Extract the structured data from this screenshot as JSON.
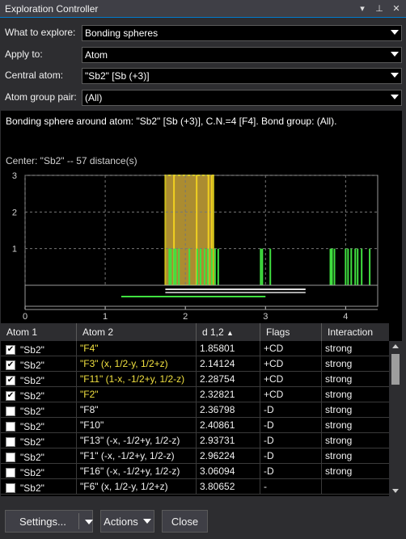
{
  "window": {
    "title": "Exploration Controller"
  },
  "form": {
    "explore_label": "What to explore:",
    "explore_value": "Bonding spheres",
    "apply_label": "Apply to:",
    "apply_value": "Atom",
    "central_label": "Central atom:",
    "central_value": "\"Sb2\" [Sb (+3)]",
    "pair_label": "Atom group pair:",
    "pair_value": "(All)"
  },
  "info": {
    "description": "Bonding sphere around atom: \"Sb2\" [Sb (+3)], C.N.=4 [F4]. Bond group: (All).",
    "center": "Center: \"Sb2\" -- 57 distance(s)"
  },
  "chart_data": {
    "type": "bar",
    "title": "",
    "x_ticks": [
      "0",
      "1",
      "2",
      "3",
      "4"
    ],
    "y_ticks": [
      "1",
      "2",
      "3"
    ],
    "xlim": [
      0,
      4.4
    ],
    "ylim": [
      0,
      3
    ],
    "highlight_range": [
      1.75,
      2.35
    ],
    "series": [
      {
        "values_x": [
          1.858,
          2.141,
          2.288,
          2.328
        ],
        "values_y": [
          3,
          3,
          3,
          3
        ],
        "color": "#f0d020"
      },
      {
        "values_x": [
          1.8,
          1.82,
          1.86,
          1.88,
          1.92,
          2.05,
          2.15,
          2.19,
          2.24,
          2.28,
          2.33,
          2.37,
          2.41,
          2.94,
          2.96,
          3.06,
          3.81,
          3.83,
          3.86,
          4.0,
          4.03,
          4.07,
          4.12,
          4.15,
          4.2,
          4.3
        ],
        "values_y": [
          1,
          1,
          1,
          1,
          1,
          1,
          1,
          1,
          1,
          1,
          1,
          1,
          1,
          1,
          1,
          1,
          1,
          1,
          1,
          1,
          1,
          1,
          1,
          1,
          1,
          1
        ],
        "color": "#40e040"
      }
    ]
  },
  "table": {
    "headers": [
      "Atom 1",
      "Atom 2",
      "d 1,2",
      "Flags",
      "Interaction"
    ],
    "rows": [
      {
        "checked": true,
        "a1": "\"Sb2\"",
        "a2": "\"F4\"",
        "d": "1.85801",
        "flags": "+CD",
        "inter": "strong",
        "hl": true
      },
      {
        "checked": true,
        "a1": "\"Sb2\"",
        "a2": "\"F3\" (x, 1/2-y, 1/2+z)",
        "d": "2.14124",
        "flags": "+CD",
        "inter": "strong",
        "hl": true
      },
      {
        "checked": true,
        "a1": "\"Sb2\"",
        "a2": "\"F11\" (1-x, -1/2+y, 1/2-z)",
        "d": "2.28754",
        "flags": "+CD",
        "inter": "strong",
        "hl": true
      },
      {
        "checked": true,
        "a1": "\"Sb2\"",
        "a2": "\"F2\"",
        "d": "2.32821",
        "flags": "+CD",
        "inter": "strong",
        "hl": true
      },
      {
        "checked": false,
        "a1": "\"Sb2\"",
        "a2": "\"F8\"",
        "d": "2.36798",
        "flags": "-D",
        "inter": "strong",
        "hl": false
      },
      {
        "checked": false,
        "a1": "\"Sb2\"",
        "a2": "\"F10\"",
        "d": "2.40861",
        "flags": "-D",
        "inter": "strong",
        "hl": false
      },
      {
        "checked": false,
        "a1": "\"Sb2\"",
        "a2": "\"F13\" (-x, -1/2+y, 1/2-z)",
        "d": "2.93731",
        "flags": "-D",
        "inter": "strong",
        "hl": false
      },
      {
        "checked": false,
        "a1": "\"Sb2\"",
        "a2": "\"F1\" (-x, -1/2+y, 1/2-z)",
        "d": "2.96224",
        "flags": "-D",
        "inter": "strong",
        "hl": false
      },
      {
        "checked": false,
        "a1": "\"Sb2\"",
        "a2": "\"F16\" (-x, -1/2+y, 1/2-z)",
        "d": "3.06094",
        "flags": "-D",
        "inter": "strong",
        "hl": false
      },
      {
        "checked": false,
        "a1": "\"Sb2\"",
        "a2": "\"F6\" (x, 1/2-y, 1/2+z)",
        "d": "3.80652",
        "flags": "-",
        "inter": "",
        "hl": false
      }
    ]
  },
  "buttons": {
    "settings": "Settings...",
    "actions": "Actions",
    "close": "Close"
  }
}
